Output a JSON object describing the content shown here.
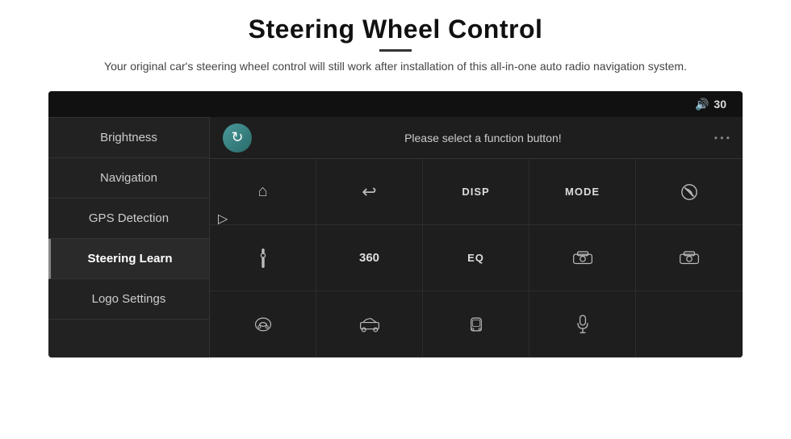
{
  "page": {
    "title": "Steering Wheel Control",
    "subtitle": "Your original car's steering wheel control will still work after installation of this all-in-one auto radio navigation system."
  },
  "topbar": {
    "volume_icon": "🔊",
    "volume_value": "30"
  },
  "sidebar": {
    "items": [
      {
        "label": "Brightness",
        "active": false
      },
      {
        "label": "Navigation",
        "active": false
      },
      {
        "label": "GPS Detection",
        "active": false
      },
      {
        "label": "Steering Learn",
        "active": true
      },
      {
        "label": "Logo Settings",
        "active": false
      }
    ]
  },
  "main": {
    "sync_icon": "↻",
    "function_text": "Please select a function button!",
    "buttons": [
      {
        "id": "home",
        "symbol": "⌂",
        "type": "icon"
      },
      {
        "id": "back",
        "symbol": "↩",
        "type": "icon"
      },
      {
        "id": "disp",
        "symbol": "DISP",
        "type": "label"
      },
      {
        "id": "mode",
        "symbol": "MODE",
        "type": "label"
      },
      {
        "id": "phone-off",
        "symbol": "🚫",
        "type": "icon"
      },
      {
        "id": "adjust",
        "symbol": "⚙",
        "type": "icon"
      },
      {
        "id": "360",
        "symbol": "360",
        "type": "label"
      },
      {
        "id": "eq",
        "symbol": "EQ",
        "type": "label"
      },
      {
        "id": "car1",
        "symbol": "🚗",
        "type": "icon"
      },
      {
        "id": "car2",
        "symbol": "🚗",
        "type": "icon"
      },
      {
        "id": "car3",
        "symbol": "🚘",
        "type": "icon"
      },
      {
        "id": "car4",
        "symbol": "🚗",
        "type": "icon"
      },
      {
        "id": "car5",
        "symbol": "🚗",
        "type": "icon"
      },
      {
        "id": "mic",
        "symbol": "🎤",
        "type": "icon"
      },
      {
        "id": "empty",
        "symbol": "",
        "type": "empty"
      }
    ]
  }
}
